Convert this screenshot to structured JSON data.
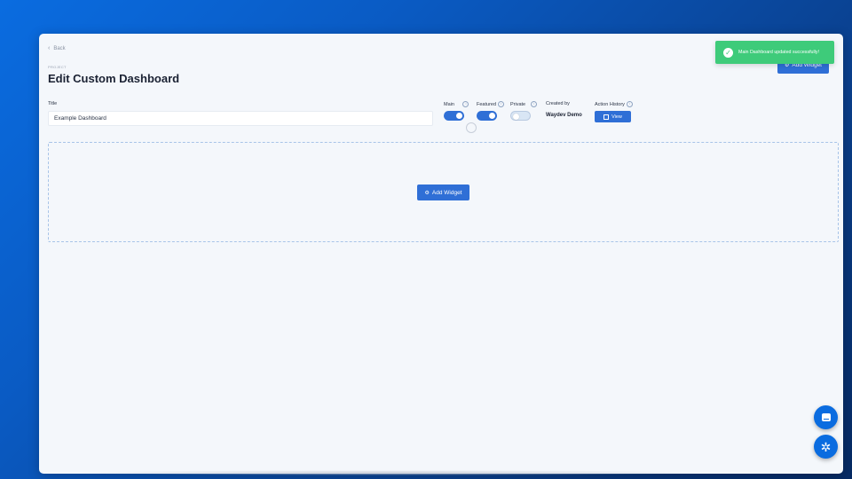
{
  "header": {
    "back_label": "Back",
    "eyebrow": "PROJECT",
    "title": "Edit Custom Dashboard",
    "add_widget_label": "Add Widget"
  },
  "toast": {
    "message": "Main Dashboard updated successfully!"
  },
  "form": {
    "title_label": "Title",
    "title_value": "Example Dashboard",
    "main_label": "Main",
    "main_on": true,
    "featured_label": "Featured",
    "featured_on": true,
    "private_label": "Private",
    "private_on": false,
    "created_by_label": "Created by",
    "created_by_value": "Waydev Demo",
    "action_history_label": "Action History",
    "view_label": "View"
  },
  "canvas": {
    "add_widget_label": "Add Widget"
  },
  "colors": {
    "accent": "#2f6fd6",
    "toast_green": "#3ecb7a",
    "fab_blue": "#0a6ce0"
  },
  "fabs": {
    "chat_icon": "chat-icon",
    "bug_icon": "bug-icon"
  }
}
